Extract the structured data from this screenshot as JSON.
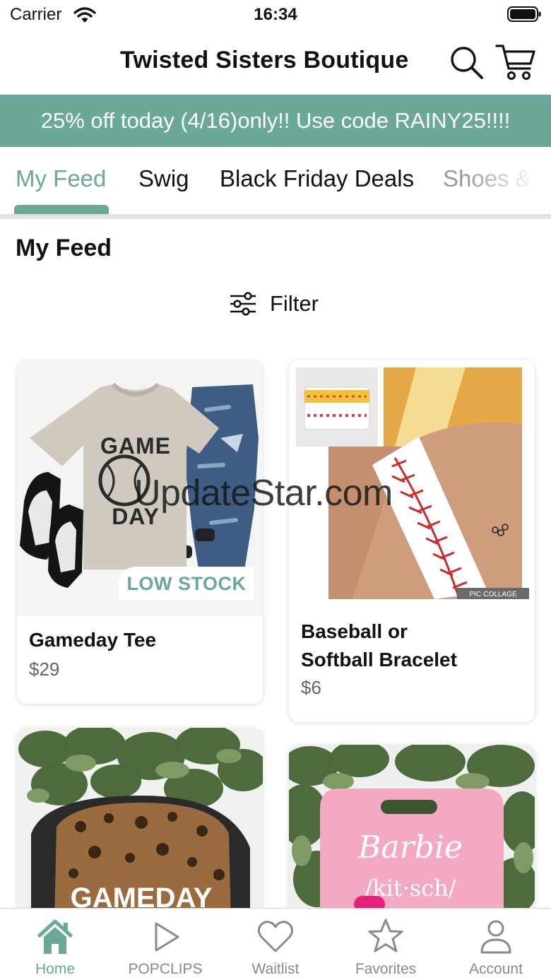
{
  "status_bar": {
    "carrier": "Carrier",
    "time": "16:34"
  },
  "header": {
    "title": "Twisted Sisters Boutique"
  },
  "promo": {
    "text": "25% off today (4/16)only!! Use code RAINY25!!!!"
  },
  "tabs": [
    {
      "label": "My Feed",
      "active": true
    },
    {
      "label": "Swig"
    },
    {
      "label": "Black Friday Deals"
    },
    {
      "label": "Shoes &"
    }
  ],
  "feed": {
    "title": "My Feed",
    "filter_label": "Filter",
    "products": [
      {
        "title": "Gameday Tee",
        "price": "$29",
        "badge": "LOW STOCK"
      },
      {
        "title_line1": "Baseball or",
        "title_line2": "Softball Bracelet",
        "price": "$6",
        "image_text": "PIC·COLLAGE"
      },
      {
        "image_text": "GAMEDAY"
      },
      {
        "image_text_1": "Barbie",
        "image_text_2": "/kit·sch/"
      }
    ]
  },
  "watermark": "UpdateStar.com",
  "tab_bar": [
    {
      "label": "Home",
      "icon": "home-icon",
      "active": true
    },
    {
      "label": "POPCLIPS",
      "icon": "play-icon"
    },
    {
      "label": "Waitlist",
      "icon": "heart-icon"
    },
    {
      "label": "Favorites",
      "icon": "star-icon"
    },
    {
      "label": "Account",
      "icon": "person-icon"
    }
  ],
  "colors": {
    "accent": "#6aa89a",
    "text": "#111111",
    "muted": "#8a8a8a",
    "card_shadow": "rgba(0,0,0,0.16)"
  }
}
